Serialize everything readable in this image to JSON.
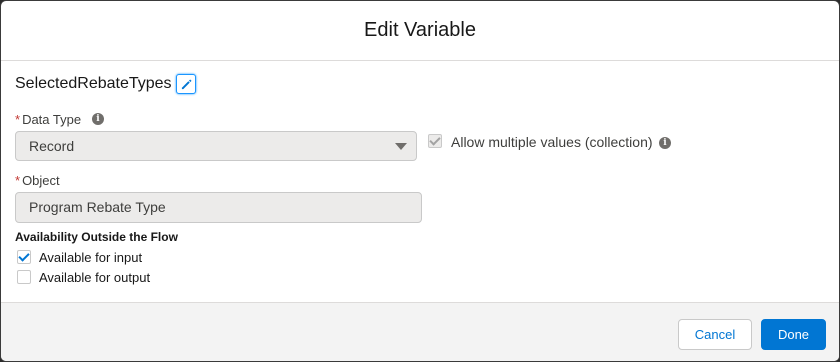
{
  "modal": {
    "title": "Edit Variable"
  },
  "variable": {
    "name": "SelectedRebateTypes"
  },
  "data_type": {
    "required_marker": "*",
    "label": "Data Type",
    "selected": "Record"
  },
  "collection": {
    "label": "Allow multiple values (collection)",
    "checked": true,
    "disabled": true
  },
  "object": {
    "required_marker": "*",
    "label": "Object",
    "value": "Program Rebate Type"
  },
  "availability": {
    "title": "Availability Outside the Flow",
    "input_label": "Available for input",
    "input_checked": true,
    "output_label": "Available for output",
    "output_checked": false
  },
  "footer": {
    "cancel_label": "Cancel",
    "done_label": "Done"
  },
  "icons": {
    "info": "info-icon",
    "edit": "pencil-icon"
  },
  "colors": {
    "brand": "#0176d3",
    "required": "#c23934",
    "field_bg": "#ecebea"
  }
}
